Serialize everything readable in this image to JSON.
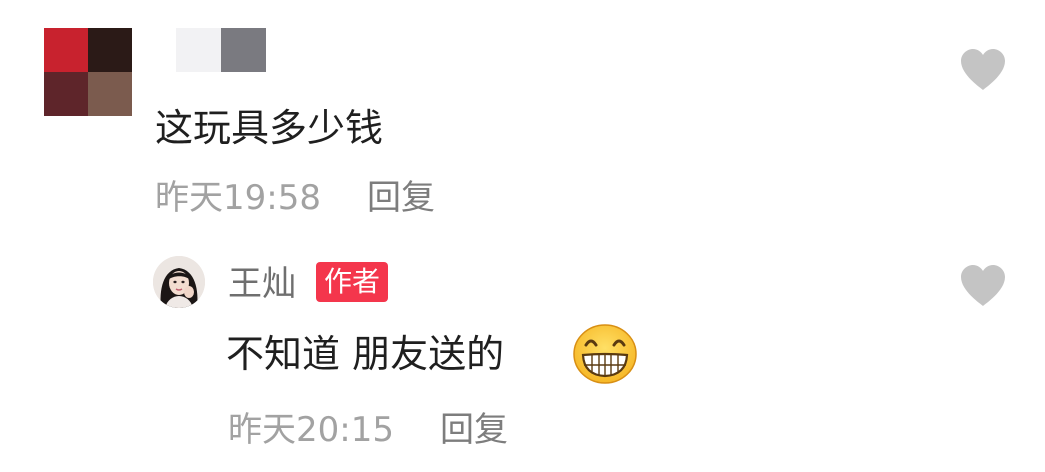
{
  "comment": {
    "avatar_mosaic_colors": [
      "#c8222e",
      "#2b1a17",
      "#5e252a",
      "#7b5b4e"
    ],
    "username_mosaic_colors": [
      "#f2f2f4",
      "#7a7a80"
    ],
    "text": "这玩具多少钱",
    "time": "昨天19:58",
    "reply_label": "回复",
    "like_icon": "heart-icon"
  },
  "reply": {
    "avatar_icon": "profile-photo",
    "username": "王灿",
    "badge": "作者",
    "text": "不知道 朋友送的",
    "emoji": "grinning-face-emoji",
    "time": "昨天20:15",
    "reply_label": "回复",
    "like_icon": "heart-icon"
  },
  "colors": {
    "badge_bg": "#f4364c",
    "meta_text": "#a2a2a2",
    "heart": "#c4c4c4"
  }
}
